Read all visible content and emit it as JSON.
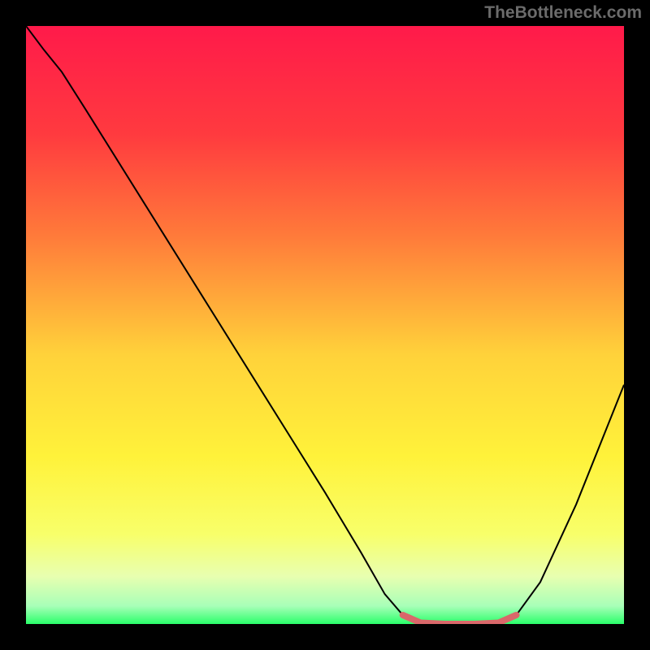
{
  "watermark": "TheBottleneck.com",
  "chart_data": {
    "type": "line",
    "title": "",
    "xlabel": "",
    "ylabel": "",
    "xlim": [
      0,
      100
    ],
    "ylim": [
      0,
      100
    ],
    "background_gradient": {
      "stops": [
        {
          "offset": 0,
          "color": "#ff1a4a"
        },
        {
          "offset": 18,
          "color": "#ff3a3f"
        },
        {
          "offset": 35,
          "color": "#ff7a3a"
        },
        {
          "offset": 55,
          "color": "#ffd23a"
        },
        {
          "offset": 72,
          "color": "#fff23a"
        },
        {
          "offset": 85,
          "color": "#f8ff6a"
        },
        {
          "offset": 92,
          "color": "#e8ffb0"
        },
        {
          "offset": 97,
          "color": "#a8ffb8"
        },
        {
          "offset": 100,
          "color": "#2aff6a"
        }
      ]
    },
    "series": [
      {
        "name": "bottleneck-curve",
        "color": "#000000",
        "stroke_width": 2,
        "points": [
          {
            "x": 0,
            "y": 100
          },
          {
            "x": 3,
            "y": 96
          },
          {
            "x": 6,
            "y": 92.3
          },
          {
            "x": 10,
            "y": 86
          },
          {
            "x": 20,
            "y": 70
          },
          {
            "x": 30,
            "y": 54
          },
          {
            "x": 40,
            "y": 38
          },
          {
            "x": 50,
            "y": 22
          },
          {
            "x": 56,
            "y": 12
          },
          {
            "x": 60,
            "y": 5
          },
          {
            "x": 63,
            "y": 1.5
          },
          {
            "x": 66,
            "y": 0.2
          },
          {
            "x": 70,
            "y": 0
          },
          {
            "x": 75,
            "y": 0
          },
          {
            "x": 79,
            "y": 0.2
          },
          {
            "x": 82,
            "y": 1.5
          },
          {
            "x": 86,
            "y": 7
          },
          {
            "x": 92,
            "y": 20
          },
          {
            "x": 100,
            "y": 40
          }
        ]
      }
    ],
    "optimal_zone": {
      "color": "#d9686a",
      "stroke_width": 8,
      "points": [
        {
          "x": 63,
          "y": 1.5
        },
        {
          "x": 66,
          "y": 0.2
        },
        {
          "x": 70,
          "y": 0
        },
        {
          "x": 75,
          "y": 0
        },
        {
          "x": 79,
          "y": 0.2
        },
        {
          "x": 82,
          "y": 1.5
        }
      ]
    }
  }
}
